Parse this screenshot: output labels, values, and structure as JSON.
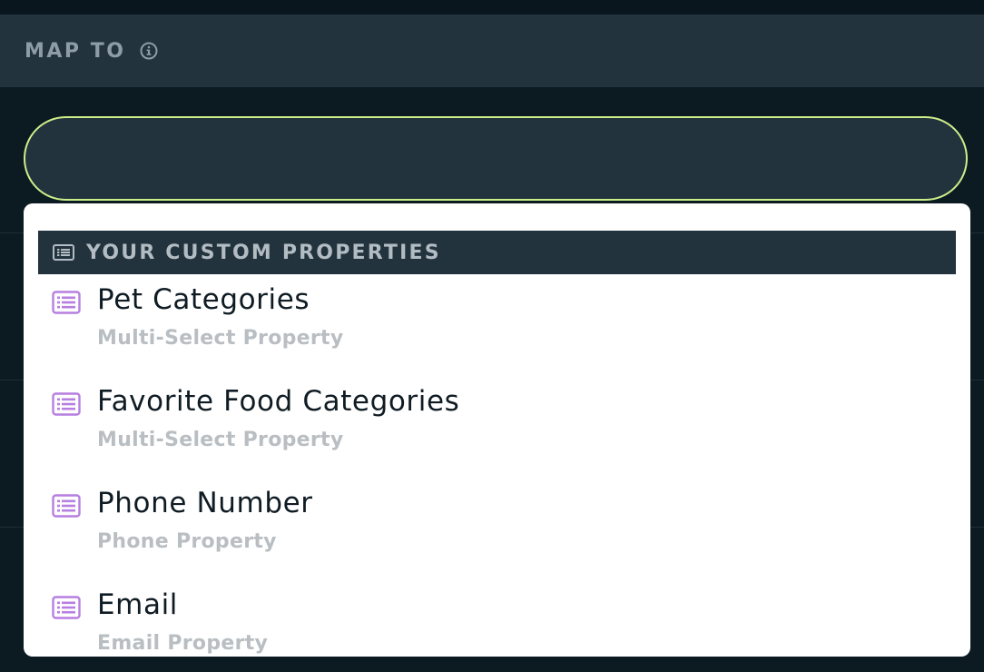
{
  "header": {
    "title": "MAP TO",
    "info_icon": "info-circle-icon"
  },
  "select": {
    "value": ""
  },
  "dropdown": {
    "group_label": "YOUR CUSTOM PROPERTIES",
    "group_icon": "list-icon",
    "options": [
      {
        "title": "Pet Categories",
        "subtitle": "Multi-Select Property",
        "icon": "list-icon"
      },
      {
        "title": "Favorite Food Categories",
        "subtitle": "Multi-Select Property",
        "icon": "list-icon"
      },
      {
        "title": "Phone Number",
        "subtitle": "Phone Property",
        "icon": "list-icon"
      },
      {
        "title": "Email",
        "subtitle": "Email Property",
        "icon": "list-icon"
      }
    ]
  },
  "colors": {
    "background": "#0c1a22",
    "panel": "#22333e",
    "focus_border": "#cdef8a",
    "icon_accent": "#b77fe0",
    "title_text": "#101c24",
    "subtitle_text": "#b9bec2"
  }
}
